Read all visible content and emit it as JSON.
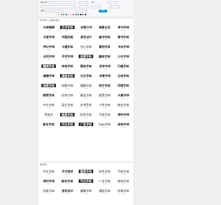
{
  "toolbar": {
    "text_label": "输入文字",
    "text_value": "",
    "size_label": "字号",
    "size_value": "",
    "color_label": "颜色",
    "generate_label": "生成",
    "colors": [
      "#e8e8e8",
      "#ff4d4d",
      "#2bc24e",
      "#2e6de0",
      "#f9c31b",
      "#d6d6d6",
      "#e04f9e",
      "#0aa0c8",
      "#555555",
      "#222222",
      "#9b59b6",
      "#333333"
    ]
  },
  "panel1": {
    "title": "热门推荐 · 点击图片选择",
    "fonts": [
      {
        "art": "天使翅膀",
        "cap": "方正字迹",
        "style": "brush"
      },
      {
        "art": "艺术字体",
        "cap": "金梅字体",
        "style": "dark"
      },
      {
        "art": "毛笔行书",
        "cap": "方正字迹",
        "style": "brush"
      },
      {
        "art": "禅意古风",
        "cap": "汉仪字体",
        "style": ""
      },
      {
        "art": "草书字体",
        "cap": "方正字迹",
        "style": "brush"
      },
      {
        "art": "可爱字体",
        "cap": "方正字迹",
        "style": "brush"
      },
      {
        "art": "中国风格",
        "cap": "方正字迹",
        "style": ""
      },
      {
        "art": "签名设计",
        "cap": "汉仪字体",
        "style": "brush"
      },
      {
        "art": "楷书字体",
        "cap": "方正字迹",
        "style": ""
      },
      {
        "art": "隶书字体",
        "cap": "方正字迹",
        "style": ""
      },
      {
        "art": "梦幻字体",
        "cap": "方正字迹",
        "style": "brush"
      },
      {
        "art": "卡通字体",
        "cap": "方正字迹",
        "style": ""
      },
      {
        "art": "空心字体",
        "cap": "方正字迹",
        "style": "thin"
      },
      {
        "art": "篆刻字体",
        "cap": "方正字迹",
        "style": ""
      },
      {
        "art": "书法字体",
        "cap": "方正字迹",
        "style": "brush"
      },
      {
        "art": "古风字体",
        "cap": "方正字迹",
        "style": "brush"
      },
      {
        "art": "手写字体",
        "cap": "方正字迹",
        "style": "brush"
      },
      {
        "art": "创意字体",
        "cap": "方正字迹",
        "style": "dark"
      },
      {
        "art": "圆体字体",
        "cap": "方正字迹",
        "style": ""
      },
      {
        "art": "少女字体",
        "cap": "方正字迹",
        "style": "brush"
      },
      {
        "art": "魏碑字体",
        "cap": "方正字迹",
        "style": "dark"
      },
      {
        "art": "宋体字体",
        "cap": "方正字迹",
        "style": ""
      },
      {
        "art": "黑体字体",
        "cap": "方正字迹",
        "style": ""
      },
      {
        "art": "花体字体",
        "cap": "方正字迹",
        "style": "brush"
      },
      {
        "art": "行楷字体",
        "cap": "方正字迹",
        "style": ""
      },
      {
        "art": "童趣字体",
        "cap": "方正字迹",
        "style": "brush"
      },
      {
        "art": "漫画字体",
        "cap": "方正字迹",
        "style": "dark"
      },
      {
        "art": "方正字体",
        "cap": "方正字迹",
        "style": ""
      },
      {
        "art": "毛笔字体",
        "cap": "方正字迹",
        "style": "brush"
      },
      {
        "art": "立体字体",
        "cap": "方正字迹",
        "style": ""
      },
      {
        "art": "海报字体",
        "cap": "方正字迹",
        "style": "dark"
      },
      {
        "art": "标题字体",
        "cap": "方正字迹",
        "style": "thin"
      },
      {
        "art": "细圆字体",
        "cap": "方正字迹",
        "style": "thin"
      },
      {
        "art": "综艺字体",
        "cap": "方正字迹",
        "style": ""
      },
      {
        "art": "印章字体",
        "cap": "方正字迹",
        "style": ""
      },
      {
        "art": "胖胖字体",
        "cap": "方正字迹",
        "style": ""
      },
      {
        "art": "仿宋字体",
        "cap": "方正字迹",
        "style": "thin"
      },
      {
        "art": "瘦金字体",
        "cap": "方正字迹",
        "style": "thin"
      },
      {
        "art": "雅黑字体",
        "cap": "方正字迹",
        "style": "thin"
      },
      {
        "art": "水墨字体",
        "cap": "方正字迹",
        "style": "brush"
      },
      {
        "art": "中文字体",
        "cap": "方正字迹",
        "style": "thin"
      },
      {
        "art": "英文字体",
        "cap": "方正字迹",
        "style": "thin"
      },
      {
        "art": "艺术签名",
        "cap": "方正字迹",
        "style": "thin"
      },
      {
        "art": "个性字体",
        "cap": "方正字迹",
        "style": "thin"
      },
      {
        "art": "商务字体",
        "cap": "方正字迹",
        "style": "thin"
      },
      {
        "art": "黑体字",
        "cap": "方正字迹",
        "style": "thin"
      },
      {
        "art": "粗黑字体",
        "cap": "方正字迹",
        "style": "dark"
      },
      {
        "art": "彩色字体",
        "cap": "方正字迹",
        "style": "thin"
      },
      {
        "art": "手绘字体",
        "cap": "方正字迹",
        "style": "thin"
      },
      {
        "art": "简约字体",
        "cap": "方正字迹",
        "style": "brush"
      },
      {
        "art": "新年字体",
        "cap": "方正字迹",
        "style": ""
      },
      {
        "art": "节日字体",
        "cap": "方正字迹",
        "style": "dark"
      },
      {
        "art": "广告字体",
        "cap": "方正字迹",
        "style": "dark"
      },
      {
        "art": "logo字体",
        "cap": "方正字迹",
        "style": "thin"
      },
      {
        "art": "装饰字体",
        "cap": "方正字迹",
        "style": "brush"
      }
    ]
  },
  "panel2": {
    "title": "最近使用",
    "fonts": [
      {
        "art": "中文字体",
        "cap": "方正字迹",
        "style": "thin"
      },
      {
        "art": "艺术签名",
        "cap": "方正字迹",
        "style": "brush"
      },
      {
        "art": "粗黑字体",
        "cap": "方正字迹",
        "style": "dark"
      },
      {
        "art": "彩色字体",
        "cap": "方正字迹",
        "style": "thin"
      },
      {
        "art": "手绘字体",
        "cap": "方正字迹",
        "style": "thin"
      },
      {
        "art": "简约字体",
        "cap": "方正字迹",
        "style": "brush"
      },
      {
        "art": "新年字体",
        "cap": "方正字迹",
        "style": ""
      },
      {
        "art": "节日字体",
        "cap": "方正字迹",
        "style": "dark"
      },
      {
        "art": "广告字体",
        "cap": "方正字迹",
        "style": "thin"
      },
      {
        "art": "装饰字体",
        "cap": "方正字迹",
        "style": "thin"
      },
      {
        "art": "创意字体",
        "cap": "方正字迹",
        "style": "thin"
      },
      {
        "art": "签名设计",
        "cap": "方正字迹",
        "style": "brush"
      },
      {
        "art": "童趣字体",
        "cap": "方正字迹",
        "style": "thin"
      },
      {
        "art": "漫画字体",
        "cap": "方正字迹",
        "style": "thin"
      },
      {
        "art": "毛笔字体",
        "cap": "方正字迹",
        "style": "thin"
      }
    ]
  }
}
